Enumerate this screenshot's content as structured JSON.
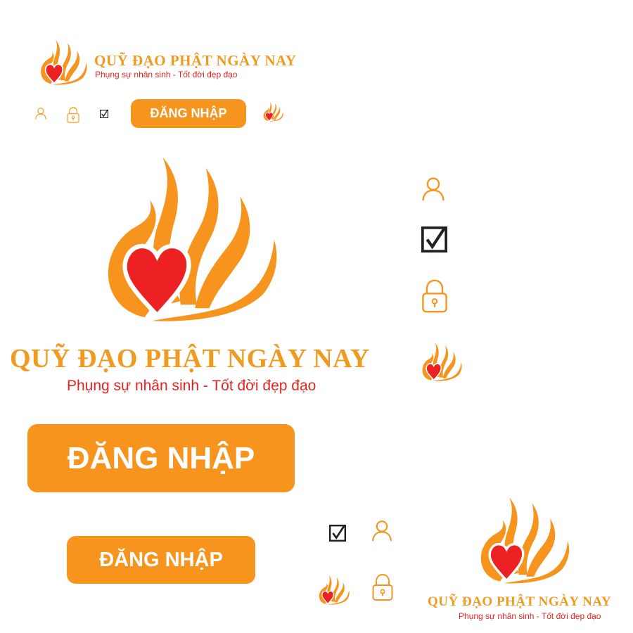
{
  "brand": {
    "name": "QUỸ ĐẠO PHẬT NGÀY NAY",
    "tagline": "Phụng sự nhân sinh - Tốt đời đẹp đạo"
  },
  "login_button": {
    "label": "ĐĂNG NHẬP"
  },
  "icons": {
    "user": "user-icon",
    "lock": "lock-icon",
    "checkbox": "checked-checkbox-icon",
    "logo": "flame-heart-logo"
  },
  "colors": {
    "orange": "#F7941D",
    "red": "#ED2024",
    "title_orange": "#F09A1F",
    "tagline_red": "#E52421",
    "dark": "#231F20",
    "white": "#FFFFFF"
  }
}
